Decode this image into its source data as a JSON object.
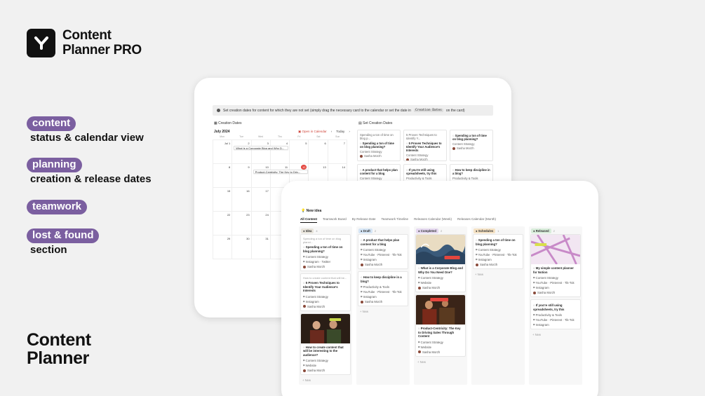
{
  "brand": {
    "name_line1": "Content",
    "name_line2": "Planner PRO"
  },
  "features": [
    {
      "pill": "content",
      "sub": "status & calendar view"
    },
    {
      "pill": "planning",
      "sub": "creation & release dates"
    },
    {
      "pill": "teamwork",
      "sub": ""
    },
    {
      "pill": "lost & found",
      "sub": "section"
    }
  ],
  "bottom_title": {
    "line1": "Content",
    "line2": "Planner"
  },
  "colors": {
    "accent": "#7b5fa0",
    "today": "#e3463e"
  },
  "back": {
    "banner_text": "Set creation dates for content for which they are not set (simply drag the necessary card to the calendar or set the date in",
    "banner_code": "Creation Dates",
    "banner_tail": "on the card)",
    "calendar_title": "Creation Dates",
    "month": "July 2024",
    "open_in_calendar": "Open in Calendar",
    "today_label": "Today",
    "weekdays": [
      "Mon",
      "Tue",
      "Wed",
      "Thu",
      "Fri",
      "Sat",
      "Sun"
    ],
    "days": [
      "Jul 1",
      "2",
      "3",
      "4",
      "5",
      "6",
      "7",
      "8",
      "9",
      "10",
      "11",
      "12",
      "13",
      "14",
      "15",
      "16",
      "17",
      "18",
      "19",
      "20",
      "21",
      "22",
      "23",
      "24",
      "25",
      "26",
      "27",
      "28",
      "29",
      "30",
      "31",
      "",
      "",
      "",
      ""
    ],
    "event1": "What is a Corporate Blog and Why D...",
    "event2": "Product-Centricity: The Key to Driv...",
    "set_title": "Set Creation Dates",
    "cards": [
      {
        "pre": "Spending a ton of time on blog p...",
        "title": "Spending a ton of time on blog planning?",
        "prop": "Content Strategy",
        "person": "Sasha Morzh"
      },
      {
        "pre": "5 Proven Techniques to Identify Y...",
        "title": "5 Proven Techniques to Identify Your Audience's Interests",
        "prop": "Content Strategy",
        "person": "Sasha Morzh"
      },
      {
        "pre": "",
        "title": "Spending a ton of time on blog planning?",
        "prop": "Content Strategy",
        "person": "Sasha Morzh"
      },
      {
        "pre": "",
        "title": "A product that helps plan content for a blog",
        "prop": "Content Strategy",
        "person": ""
      },
      {
        "pre": "",
        "title": "If you're still using spreadsheets, try this",
        "prop": "Productivity & Tools",
        "person": ""
      },
      {
        "pre": "",
        "title": "How to keep discipline in a blog?",
        "prop": "Productivity & Tools",
        "person": ""
      }
    ]
  },
  "front": {
    "title": "New idea",
    "tabs": [
      "All Content",
      "Teamwork Board",
      "By Release Date",
      "Teamwork Timeline",
      "Releases Calendar (Week)",
      "Releases Calendar (Month)"
    ],
    "new_label": "+ New",
    "columns": [
      {
        "status": "Idea",
        "count": "4",
        "color": "#e8e4db",
        "cards": [
          {
            "pre": "Spending a ton of time on blog planni...",
            "title": "Spending a ton of time on blog planning?",
            "props": [
              "Content Strategy",
              "Instagram · Twitter"
            ],
            "person": "Sasha Morzh"
          },
          {
            "pre": "How to create content that will be...",
            "title": "5 Proven Techniques to Identify Your Audience's Interests",
            "props": [
              "Content Strategy",
              "Instagram"
            ],
            "person": "Sasha Morzh"
          },
          {
            "pre": "",
            "title": "How to create content that will be interesting to the audience?",
            "props": [
              "Content Strategy",
              "Website"
            ],
            "person": "Sasha Morzh",
            "image": "painting-2"
          }
        ]
      },
      {
        "status": "Draft",
        "count": "2",
        "color": "#d5e5f5",
        "cards": [
          {
            "pre": "",
            "title": "A product that helps plan content for a blog",
            "props": [
              "Content Strategy",
              "YouTube · Pinterest · Tik-Tok",
              "Instagram"
            ],
            "person": "Sasha Morzh"
          },
          {
            "pre": "",
            "title": "How to keep discipline in a blog?",
            "props": [
              "Productivity & Tools",
              "YouTube · Pinterest · Tik-Tok",
              "Instagram"
            ],
            "person": "Sasha Morzh"
          }
        ]
      },
      {
        "status": "Completed",
        "count": "2",
        "color": "#e5d8f0",
        "cards": [
          {
            "pre": "",
            "title": "What is a Corporate Blog and Why Do You Need One?",
            "props": [
              "Content Strategy",
              "Website"
            ],
            "person": "Sasha Morzh",
            "image": "wave"
          },
          {
            "pre": "",
            "title": "Product-Centricity: The Key to Driving Sales Through Content",
            "props": [
              "Content Strategy",
              "Website"
            ],
            "person": "Sasha Morzh",
            "image": "painting-1"
          }
        ]
      },
      {
        "status": "Schedules",
        "count": "1",
        "color": "#f5e2c4",
        "cards": [
          {
            "pre": "",
            "title": "Spending a ton of time on blog planning?",
            "props": [
              "Content Strategy",
              "YouTube · Pinterest · Tik-Tok",
              "Instagram"
            ],
            "person": "Sasha Morzh"
          }
        ]
      },
      {
        "status": "Released",
        "count": "2",
        "color": "#d7ecd9",
        "cards": [
          {
            "pre": "",
            "title": "My simple content planner for Notion",
            "props": [
              "Content Strategy",
              "YouTube · Pinterest · Tik-Tok",
              "Instagram"
            ],
            "person": "Sasha Morzh",
            "image": "map"
          },
          {
            "pre": "",
            "title": "If you're still using spreadsheets, try this",
            "props": [
              "Productivity & Tools",
              "YouTube · Pinterest · Tik-Tok",
              "Instagram"
            ],
            "person": ""
          }
        ]
      }
    ]
  }
}
